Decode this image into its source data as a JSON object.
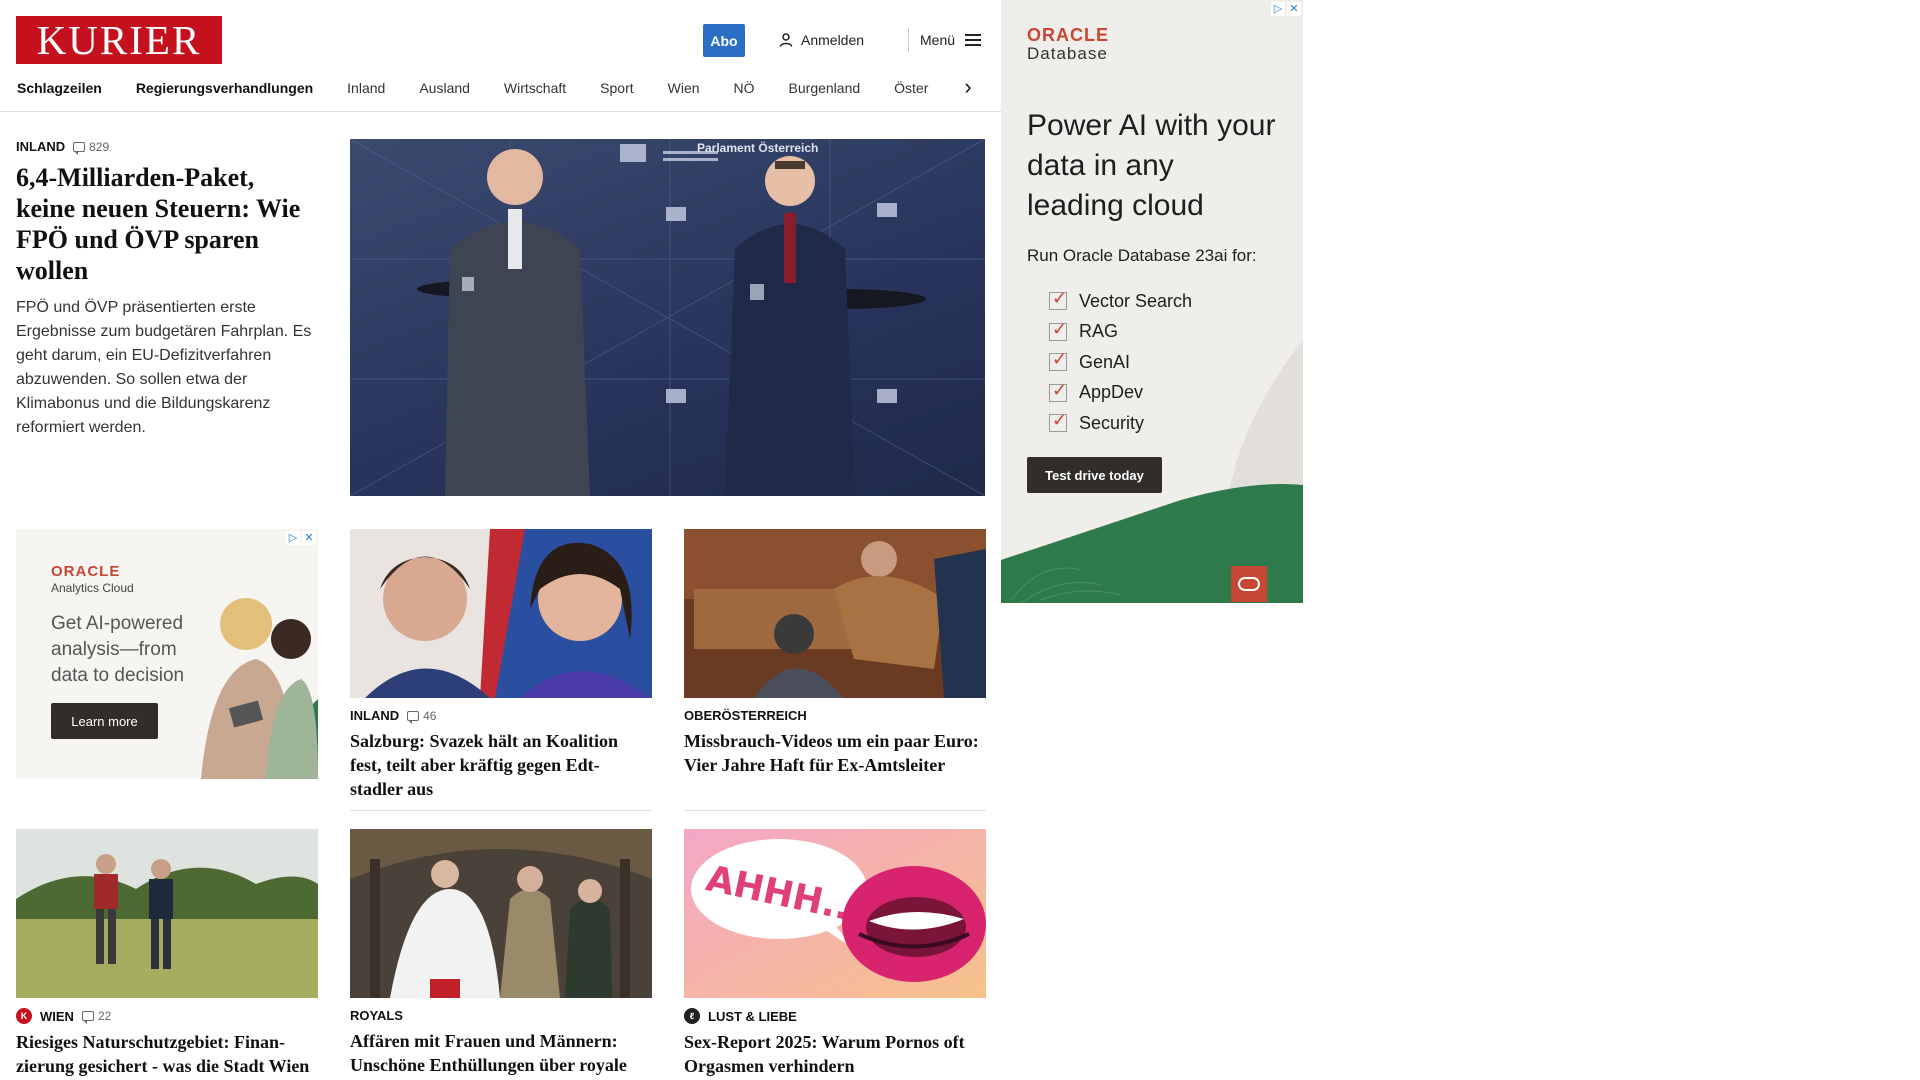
{
  "header": {
    "logo": "KURIER",
    "abo_label": "Abo",
    "login_label": "Anmelden",
    "menu_label": "Menü"
  },
  "nav": {
    "items": [
      "Schlagzeilen",
      "Regierungsverhandlungen",
      "Inland",
      "Ausland",
      "Wirtschaft",
      "Sport",
      "Wien",
      "NÖ",
      "Burgenland",
      "Öster"
    ]
  },
  "lead": {
    "category": "INLAND",
    "comments": "829",
    "title": "6,4-Milliarden-Paket, keine neuen Steuern: Wie FPÖ und ÖVP sparen wollen",
    "description": "FPÖ und ÖVP präsentierten erste Ergebnisse zum budgetären Fahrplan. Es geht darum, ein EU-Defizitverfahren abzuwenden. So sollen etwa der Klimabonus und die Bildungskarenz reformiert werden.",
    "image_text": "Parlament Österreich"
  },
  "ad_small": {
    "brand": "ORACLE",
    "product": "Analytics Cloud",
    "headline": "Get AI-powered analysis—from data to decision",
    "cta": "Learn more"
  },
  "cards": [
    {
      "category": "INLAND",
      "comments": "46",
      "title": "Salzburg: Svazek hält an Koalition fest, teilt aber kräftig gegen Edt-stadler aus"
    },
    {
      "category": "OBERÖSTERREICH",
      "comments": "",
      "title": "Missbrauch-Videos um ein paar Euro: Vier Jahre Haft für Ex-Amtsleiter"
    },
    {
      "category": "WIEN",
      "comments": "22",
      "title": "Riesiges Naturschutzgebiet: Finan-zierung gesichert - was die Stadt Wien jetzt plant"
    },
    {
      "category": "ROYALS",
      "comments": "",
      "title": "Affären mit Frauen und Männern: Unschöne Enthüllungen über royale Ehe"
    },
    {
      "category": "LUST & LIEBE",
      "comments": "",
      "title": "Sex-Report 2025: Warum Pornos oft Orgasmen verhindern",
      "image_text": "AHHH..."
    }
  ],
  "ad_big": {
    "brand": "ORACLE",
    "product": "Database",
    "headline": "Power AI with your data in any leading cloud",
    "subhead": "Run Oracle Database 23ai for:",
    "features": [
      "Vector Search",
      "RAG",
      "GenAI",
      "AppDev",
      "Security"
    ],
    "cta": "Test drive today"
  },
  "colors": {
    "brand_red": "#c4111d",
    "abo_blue": "#2c6ec3",
    "oracle_red": "#c74634",
    "oracle_green": "#2f7a4c"
  }
}
